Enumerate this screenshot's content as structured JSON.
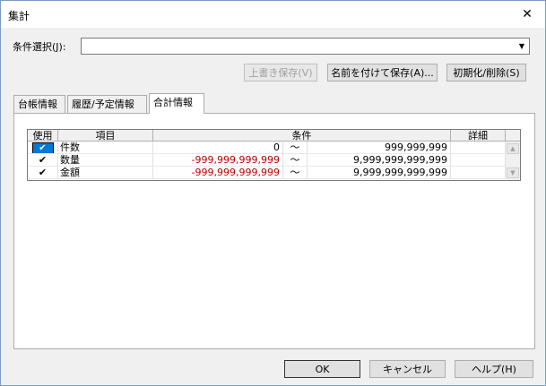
{
  "window": {
    "title": "集計",
    "close_glyph": "✕"
  },
  "condition": {
    "label": "条件選択(J):",
    "value": "",
    "arrow": "▼"
  },
  "buttons": {
    "overwrite_save": "上書き保存(V)",
    "save_as": "名前を付けて保存(A)...",
    "reset_delete": "初期化/削除(S)",
    "ok": "OK",
    "cancel": "キャンセル",
    "help": "ヘルプ(H)"
  },
  "tabs": [
    {
      "label": "台帳情報",
      "active": false
    },
    {
      "label": "履歴/予定情報",
      "active": false
    },
    {
      "label": "合計情報",
      "active": true
    }
  ],
  "grid": {
    "headers": {
      "use": "使用",
      "item": "項目",
      "condition": "条件",
      "detail": "詳細"
    },
    "rows": [
      {
        "checked": "✔",
        "item": "件数",
        "from": "0",
        "tilde": "〜",
        "to": "999,999,999",
        "from_color": "#000000"
      },
      {
        "checked": "✔",
        "item": "数量",
        "from": "-999,999,999,999",
        "tilde": "〜",
        "to": "9,999,999,999,999",
        "from_color": "#c00000"
      },
      {
        "checked": "✔",
        "item": "金額",
        "from": "-999,999,999,999",
        "tilde": "〜",
        "to": "9,999,999,999,999",
        "from_color": "#c00000"
      }
    ],
    "scroll_up": "▲",
    "scroll_down": "▼"
  }
}
